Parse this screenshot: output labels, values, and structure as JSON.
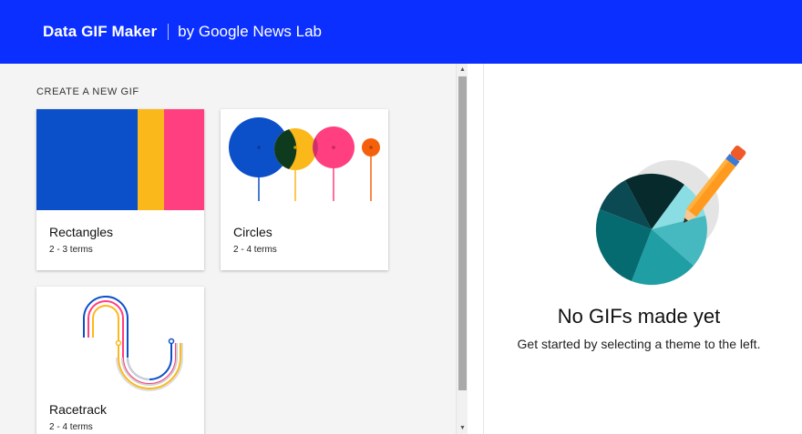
{
  "header": {
    "app_title": "Data GIF Maker",
    "subtitle": "by Google News Lab",
    "background_color": "#0a2fff"
  },
  "gallery": {
    "section_title": "CREATE A NEW GIF",
    "cards": [
      {
        "name": "Rectangles",
        "terms": "2 - 3 terms"
      },
      {
        "name": "Circles",
        "terms": "2 - 4 terms"
      },
      {
        "name": "Racetrack",
        "terms": "2 - 4 terms"
      }
    ]
  },
  "empty_state": {
    "title": "No GIFs made yet",
    "message": "Get started by selecting a theme to the left.",
    "illustration": "pie-chart-with-pencil-icon"
  },
  "colors": {
    "blue": "#0b4fc9",
    "yellow": "#fbb81b",
    "pink": "#ff3f7f",
    "orange": "#f4600c"
  }
}
